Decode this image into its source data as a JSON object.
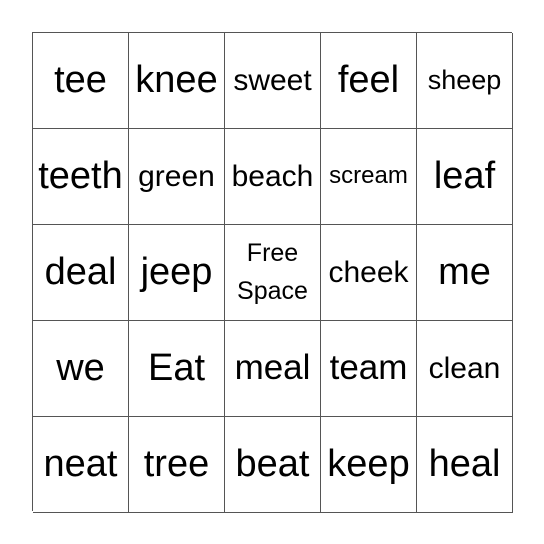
{
  "board": {
    "cells": [
      "tee",
      "knee",
      "sweet",
      "feel",
      "sheep",
      "teeth",
      "green",
      "beach",
      "scream",
      "leaf",
      "deal",
      "jeep",
      "Free Space",
      "cheek",
      "me",
      "we",
      "Eat",
      "meal",
      "team",
      "clean",
      "neat",
      "tree",
      "beat",
      "keep",
      "heal"
    ]
  }
}
